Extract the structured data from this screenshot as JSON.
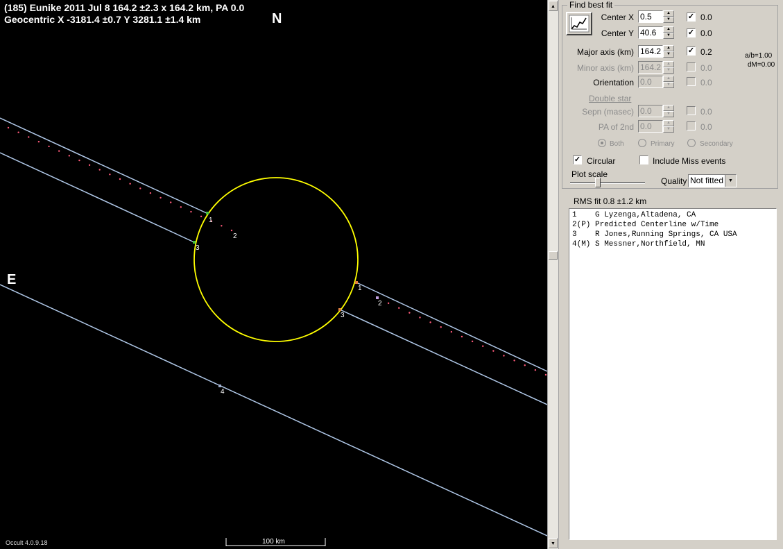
{
  "plot": {
    "title_line1": "(185) Eunike  2011 Jul 8   164.2 ±2.3 x 164.2 km,  PA 0.0",
    "title_line2": "Geocentric  X  -3181.4 ±0.7  Y 3281.1 ±1.4 km",
    "north_label": "N",
    "east_label": "E",
    "version": "Occult 4.0.9.18",
    "scale_label": "100 km",
    "event_labels": {
      "top_d": "1",
      "top_c2": "2",
      "top_r": "3",
      "bot_d": "1",
      "bot_c2": "2",
      "bot_r": "3",
      "miss": "4"
    },
    "colors": {
      "background": "#000000",
      "ellipse": "#ffff00",
      "chord": "#b0c8e8",
      "predicted": "#ff5a7a"
    }
  },
  "panel": {
    "group_title": "Find best fit",
    "center_x": {
      "label": "Center X",
      "value": "0.5",
      "checked": true,
      "uncert": "0.0"
    },
    "center_y": {
      "label": "Center Y",
      "value": "40.6",
      "checked": true,
      "uncert": "0.0"
    },
    "major": {
      "label": "Major axis (km)",
      "value": "164.2",
      "checked": true,
      "uncert": "0.2"
    },
    "minor": {
      "label": "Minor axis (km)",
      "value": "164.2",
      "checked": false,
      "uncert": "0.0"
    },
    "orient": {
      "label": "Orientation",
      "value": "0.0",
      "checked": false,
      "uncert": "0.0"
    },
    "ab_ratio": "a/b=1.00",
    "dm": "dM=0.00",
    "double_star": "Double star",
    "sepn": {
      "label": "Sepn (masec)",
      "value": "0.0",
      "uncert": "0.0"
    },
    "pa2": {
      "label": "PA of 2nd",
      "value": "0.0",
      "uncert": "0.0"
    },
    "radio_both": "Both",
    "radio_primary": "Primary",
    "radio_secondary": "Secondary",
    "circular": "Circular",
    "include_miss": "Include Miss events",
    "plot_scale": "Plot scale",
    "quality_label": "Quality",
    "quality_value": "Not fitted",
    "rms_fit": "RMS fit  0.8 ±1.2 km"
  },
  "observers": [
    "1    G Lyzenga,Altadena, CA",
    "2(P) Predicted Centerline w/Time",
    "3    R Jones,Running Springs, CA USA",
    "4(M) S Messner,Northfield, MN"
  ]
}
